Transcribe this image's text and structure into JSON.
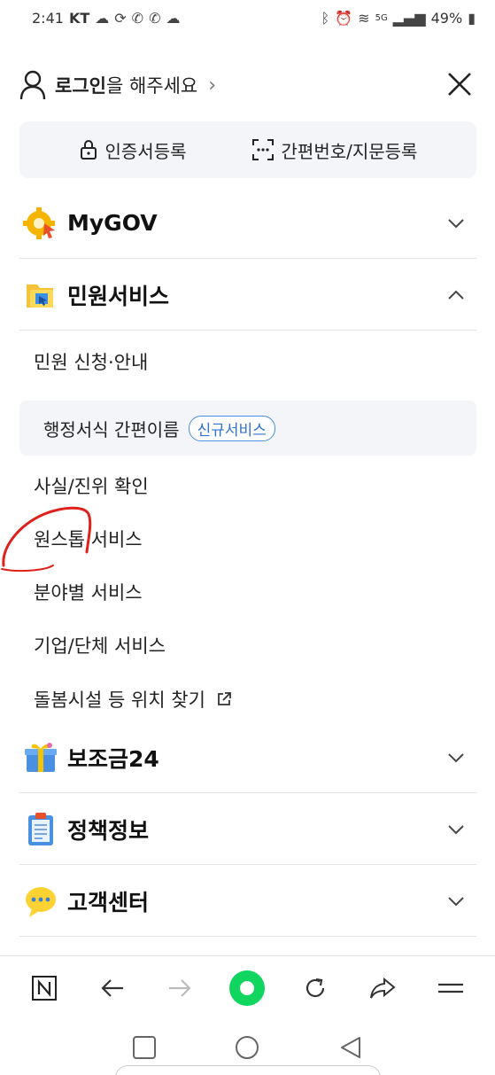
{
  "status_bar": {
    "time": "2:41",
    "carrier": "KT",
    "network": "5G",
    "battery": "49%"
  },
  "login": {
    "bold": "로그인",
    "rest": "을 해주세요"
  },
  "cert_box": {
    "cert_register": "인증서등록",
    "simple_register": "간편번호/지문등록"
  },
  "sections": [
    {
      "title": "MyGOV",
      "icon": "gear-icon",
      "expanded": false
    },
    {
      "title": "민원서비스",
      "icon": "folder-icon",
      "expanded": true
    },
    {
      "title": "보조금24",
      "icon": "gift-icon",
      "expanded": false
    },
    {
      "title": "정책정보",
      "icon": "clipboard-icon",
      "expanded": false
    },
    {
      "title": "고객센터",
      "icon": "speech-bubble-icon",
      "expanded": false
    }
  ],
  "civil_service_items": {
    "apply": "민원 신청·안내",
    "admin_form": "행정서식 간편이름",
    "new_badge": "신규서비스",
    "fact_check": "사실/진위 확인",
    "one_stop": "원스톱 서비스",
    "by_field": "분야별 서비스",
    "corporate": "기업/단체 서비스",
    "care_location": "돌봄시설 등 위치 찾기"
  },
  "colors": {
    "accent_blue": "#2f72d0",
    "naver_green": "#10d660",
    "annotation_red": "#e0201a",
    "box_bg": "#f3f5f8"
  }
}
